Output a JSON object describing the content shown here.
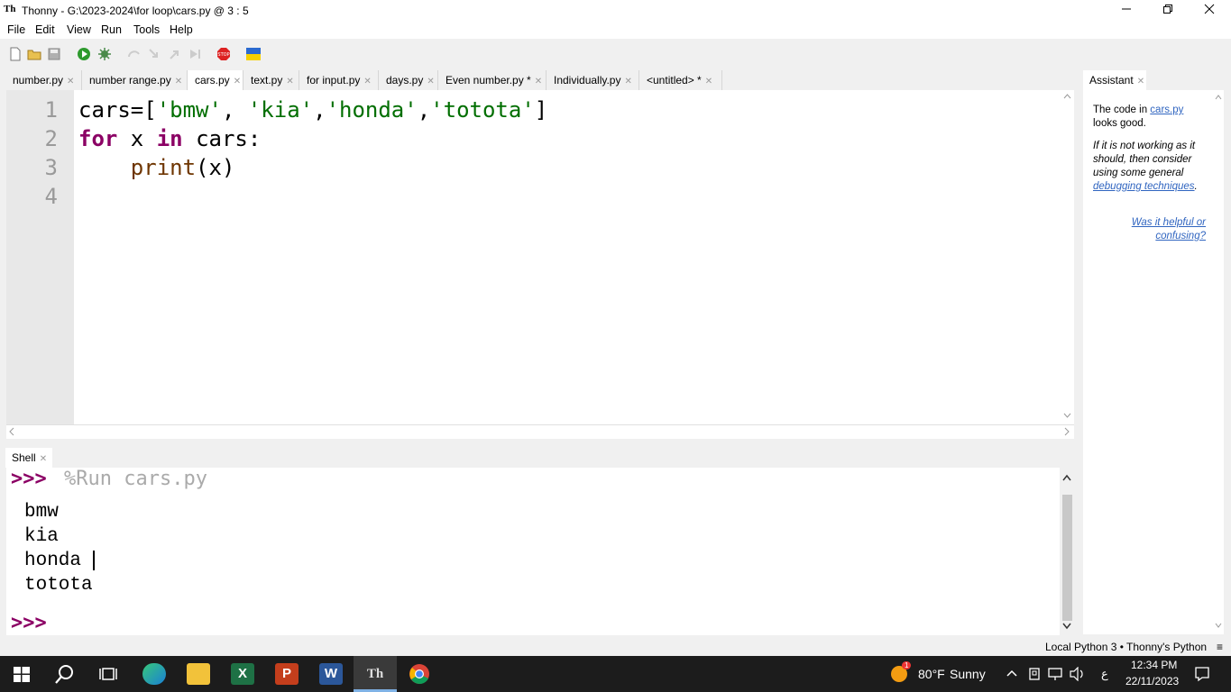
{
  "window": {
    "title": "Thonny  -  G:\\2023-2024\\for loop\\cars.py  @  3 : 5",
    "app_icon": "Th"
  },
  "menu": [
    "File",
    "Edit",
    "View",
    "Run",
    "Tools",
    "Help"
  ],
  "tabs": [
    {
      "label": "number.py"
    },
    {
      "label": "number range.py"
    },
    {
      "label": "cars.py",
      "active": true
    },
    {
      "label": "text.py"
    },
    {
      "label": "for input.py"
    },
    {
      "label": "days.py"
    },
    {
      "label": "Even number.py *"
    },
    {
      "label": "Individually.py"
    },
    {
      "label": "<untitled> *"
    }
  ],
  "editor": {
    "line_numbers": [
      "1",
      "2",
      "3",
      "4"
    ],
    "line1": {
      "a": "cars=[",
      "s1": "'bmw'",
      "b": ", ",
      "s2": "'kia'",
      "c": ",",
      "s3": "'honda'",
      "d": ",",
      "s4": "'totota'",
      "e": "]"
    },
    "line2": {
      "kw1": "for",
      "a": " x ",
      "kw2": "in",
      "b": " cars:"
    },
    "line3": {
      "indent": "    ",
      "fn": "print",
      "a": "(x)"
    }
  },
  "shell": {
    "tab_label": "Shell",
    "prompt": ">>>",
    "command": "%Run cars.py",
    "outputs": [
      "bmw",
      "kia",
      "honda",
      "totota"
    ]
  },
  "assistant": {
    "tab_label": "Assistant",
    "p1_a": "The code in ",
    "p1_link": "cars.py",
    "p1_b": " looks good.",
    "p2_a": "If it is not working as it should, then consider using some general ",
    "p2_link": "debugging techniques",
    "p2_b": ".",
    "feedback_link": "Was it helpful or confusing?"
  },
  "status": {
    "interpreter": "Local Python 3  •  Thonny's Python",
    "menu_icon": "≡"
  },
  "taskbar": {
    "weather_temp": "80°F",
    "weather_text": "Sunny",
    "weather_badge": "1",
    "lang": "ع",
    "time": "12:34 PM",
    "date": "22/11/2023"
  },
  "colors": {
    "keyword": "#8b0064",
    "string": "#006e00",
    "builtin": "#6e3500",
    "taskbar": "#1c1c1c"
  }
}
